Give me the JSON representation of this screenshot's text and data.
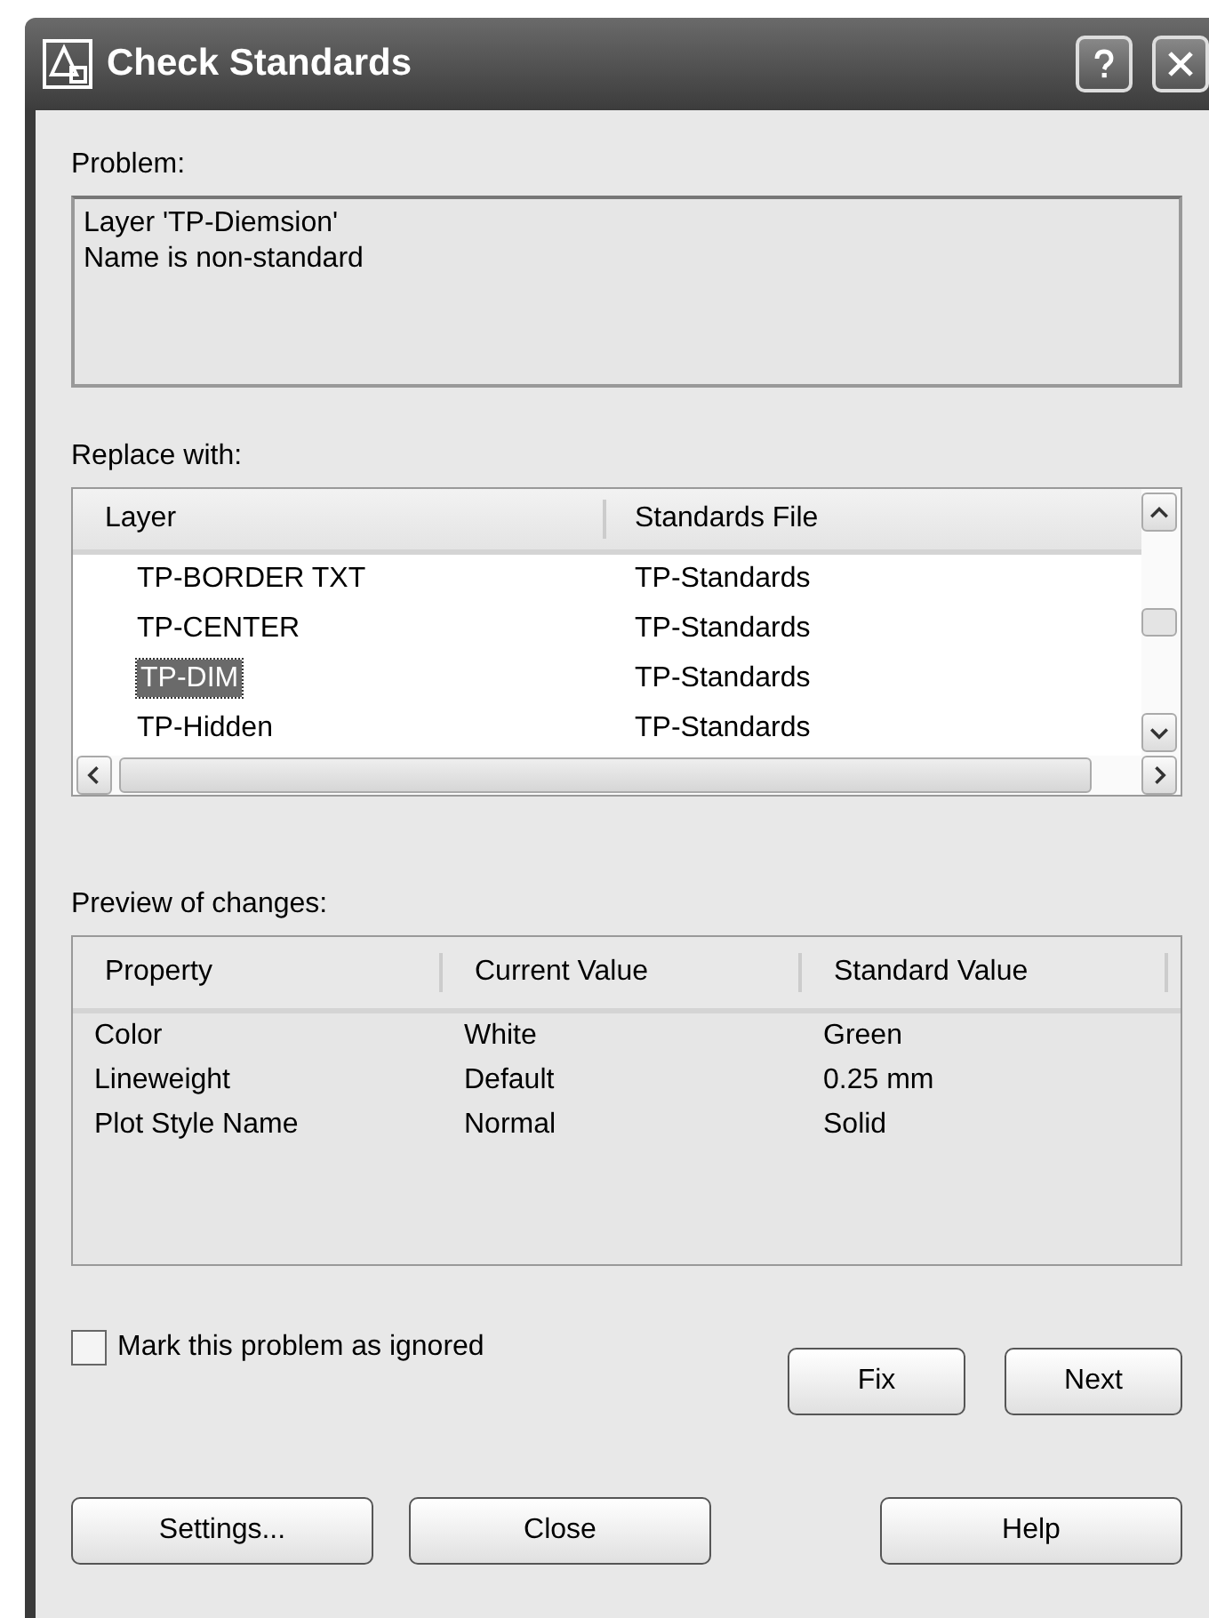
{
  "window": {
    "title": "Check Standards"
  },
  "problem": {
    "label": "Problem:",
    "lines": [
      "Layer 'TP-Diemsion'",
      "Name is non-standard"
    ]
  },
  "replace": {
    "label": "Replace with:",
    "columns": [
      "Layer",
      "Standards File"
    ],
    "rows": [
      {
        "layer": "TP-BORDER TXT",
        "file": "TP-Standards",
        "selected": false
      },
      {
        "layer": "TP-CENTER",
        "file": "TP-Standards",
        "selected": false
      },
      {
        "layer": "TP-DIM",
        "file": "TP-Standards",
        "selected": true
      },
      {
        "layer": "TP-Hidden",
        "file": "TP-Standards",
        "selected": false
      }
    ]
  },
  "preview": {
    "label": "Preview of changes:",
    "columns": [
      "Property",
      "Current Value",
      "Standard Value"
    ],
    "rows": [
      [
        "Color",
        "White",
        "Green"
      ],
      [
        "Lineweight",
        "Default",
        "0.25 mm"
      ],
      [
        "Plot Style Name",
        "Normal",
        "Solid"
      ]
    ]
  },
  "ignore": {
    "label": "Mark this problem as ignored",
    "checked": false
  },
  "action_buttons": [
    "Fix",
    "Next"
  ],
  "bottom_buttons": [
    "Settings...",
    "Close",
    "Help"
  ]
}
